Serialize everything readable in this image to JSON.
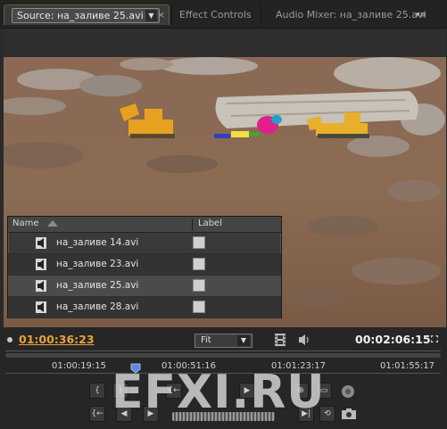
{
  "tabs": {
    "source": "Source: на_заливе 25.avi",
    "close": "×",
    "effects": "Effect Controls",
    "mixer": "Audio Mixer: на_заливе 25.avi",
    "menu": "▾≡"
  },
  "bin": {
    "col_name": "Name",
    "col_label": "Label",
    "items": [
      {
        "name": "на_заливе 14.avi"
      },
      {
        "name": "на_заливе 23.avi"
      },
      {
        "name": "на_заливе 25.avi",
        "selected": true
      },
      {
        "name": "на_заливе 28.avi"
      }
    ]
  },
  "monitor": {
    "current_time": "01:00:36:23",
    "zoom": "Fit",
    "duration": "00:02:06:15",
    "ticks": [
      "01:00:19:15",
      "01:00:51:16",
      "01:01:23:17",
      "01:01:55:17"
    ],
    "current_time_color": "#e8a23a"
  },
  "watermark": "EFXI.RU",
  "icons": {
    "file": "audio-file-icon",
    "film": "film-icon",
    "speaker": "speaker-icon",
    "playhead": "playhead-icon",
    "sort": "sort-ascending-icon"
  }
}
